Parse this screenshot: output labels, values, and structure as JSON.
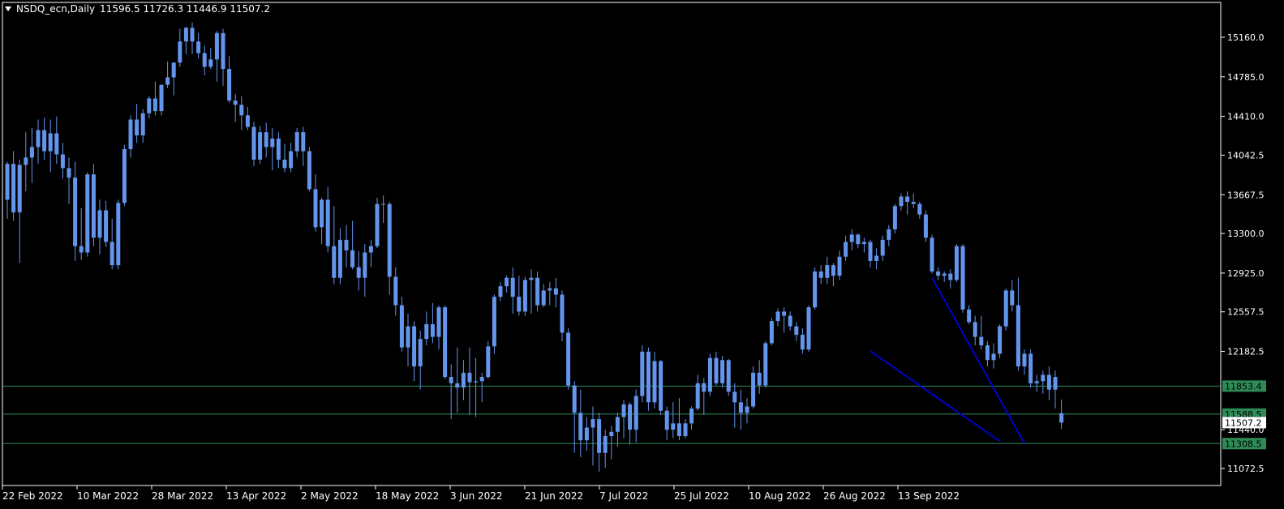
{
  "header": {
    "symbol": "NSDQ_ecn,Daily",
    "ohlc": "11596.5 11726.3 11446.9 11507.2"
  },
  "colors": {
    "background": "#000000",
    "frame": "#ffffff",
    "candle": "#6495ed",
    "level_line": "#2e8b57",
    "level_label_bg": "#2e8b57",
    "trend_line": "#0000cd",
    "current_price_bg": "#ffffff"
  },
  "price_scale": {
    "ticks": [
      "15160.0",
      "14785.0",
      "14410.0",
      "14042.5",
      "13667.5",
      "13300.0",
      "12925.0",
      "12557.5",
      "12182.5",
      "11440.0",
      "11072.5"
    ],
    "levels": [
      {
        "label": "11853.4",
        "value": 11853.4
      },
      {
        "label": "11588.5",
        "value": 11588.5
      },
      {
        "label": "11308.5",
        "value": 11308.5
      }
    ],
    "current_price": {
      "label": "11507.2",
      "value": 11507.2
    }
  },
  "time_scale": {
    "ticks": [
      "22 Feb 2022",
      "10 Mar 2022",
      "28 Mar 2022",
      "13 Apr 2022",
      "2 May 2022",
      "18 May 2022",
      "3 Jun 2022",
      "21 Jun 2022",
      "7 Jul 2022",
      "25 Jul 2022",
      "10 Aug 2022",
      "26 Aug 2022",
      "13 Sep 2022"
    ]
  },
  "chart_data": {
    "type": "candlestick",
    "symbol": "NSDQ_ecn",
    "timeframe": "Daily",
    "ylim": [
      10950,
      15500
    ],
    "last": {
      "open": 11596.5,
      "high": 11726.3,
      "low": 11446.9,
      "close": 11507.2
    },
    "trend_lines": [
      {
        "from": {
          "bar": 150,
          "price": 12880
        },
        "to": {
          "bar": 165,
          "price": 11310
        }
      },
      {
        "from": {
          "bar": 140,
          "price": 12185
        },
        "to": {
          "bar": 161,
          "price": 11330
        }
      }
    ],
    "candles": [
      [
        13620,
        13980,
        13440,
        13960
      ],
      [
        13960,
        14080,
        13420,
        13500
      ],
      [
        13500,
        14000,
        13020,
        13950
      ],
      [
        13950,
        14260,
        13700,
        14020
      ],
      [
        14020,
        14300,
        13780,
        14120
      ],
      [
        14120,
        14380,
        13960,
        14280
      ],
      [
        14280,
        14400,
        14000,
        14080
      ],
      [
        14080,
        14380,
        13880,
        14250
      ],
      [
        14250,
        14410,
        13960,
        14050
      ],
      [
        14050,
        14160,
        13820,
        13920
      ],
      [
        13920,
        14020,
        13580,
        13830
      ],
      [
        13830,
        13980,
        13040,
        13180
      ],
      [
        13180,
        13540,
        13050,
        13120
      ],
      [
        13120,
        13880,
        13080,
        13860
      ],
      [
        13860,
        13960,
        13180,
        13260
      ],
      [
        13260,
        13620,
        13100,
        13520
      ],
      [
        13520,
        13610,
        13170,
        13220
      ],
      [
        13220,
        13440,
        12960,
        13000
      ],
      [
        13000,
        13620,
        12960,
        13590
      ],
      [
        13590,
        14140,
        13560,
        14100
      ],
      [
        14100,
        14420,
        14020,
        14380
      ],
      [
        14380,
        14530,
        14160,
        14230
      ],
      [
        14230,
        14480,
        14160,
        14440
      ],
      [
        14440,
        14600,
        14390,
        14580
      ],
      [
        14580,
        14740,
        14420,
        14460
      ],
      [
        14460,
        14680,
        14420,
        14710
      ],
      [
        14710,
        14930,
        14680,
        14780
      ],
      [
        14780,
        14850,
        14610,
        14920
      ],
      [
        14920,
        15240,
        14880,
        15120
      ],
      [
        15120,
        15260,
        15000,
        15250
      ],
      [
        15250,
        15300,
        15000,
        15120
      ],
      [
        15120,
        15200,
        14960,
        15010
      ],
      [
        15010,
        15080,
        14800,
        14880
      ],
      [
        14880,
        15060,
        14860,
        14950
      ],
      [
        14950,
        15220,
        14740,
        15200
      ],
      [
        15200,
        15240,
        14700,
        14860
      ],
      [
        14860,
        14980,
        14540,
        14560
      ],
      [
        14560,
        14620,
        14360,
        14520
      ],
      [
        14520,
        14600,
        14280,
        14420
      ],
      [
        14420,
        14500,
        14280,
        14310
      ],
      [
        14310,
        14360,
        13940,
        14000
      ],
      [
        14000,
        14320,
        13960,
        14260
      ],
      [
        14260,
        14350,
        14020,
        14120
      ],
      [
        14120,
        14300,
        13900,
        14200
      ],
      [
        14200,
        14260,
        13920,
        14000
      ],
      [
        14000,
        14150,
        13880,
        13920
      ],
      [
        13920,
        14160,
        13880,
        14080
      ],
      [
        14080,
        14300,
        14020,
        14260
      ],
      [
        14260,
        14310,
        13940,
        14080
      ],
      [
        14080,
        14120,
        13700,
        13720
      ],
      [
        13720,
        13860,
        13320,
        13360
      ],
      [
        13360,
        13640,
        13200,
        13620
      ],
      [
        13620,
        13740,
        13120,
        13180
      ],
      [
        13180,
        13560,
        12820,
        12880
      ],
      [
        12880,
        13350,
        12820,
        13240
      ],
      [
        13240,
        13380,
        12980,
        13140
      ],
      [
        13140,
        13420,
        12960,
        12980
      ],
      [
        12980,
        13130,
        12760,
        12880
      ],
      [
        12880,
        13200,
        12700,
        13120
      ],
      [
        13120,
        13240,
        12980,
        13180
      ],
      [
        13180,
        13640,
        13160,
        13580
      ],
      [
        13580,
        13660,
        13400,
        13580
      ],
      [
        13580,
        13600,
        12720,
        12890
      ],
      [
        12890,
        12980,
        12520,
        12620
      ],
      [
        12620,
        12700,
        12180,
        12220
      ],
      [
        12220,
        12540,
        12040,
        12420
      ],
      [
        12420,
        12470,
        11900,
        12040
      ],
      [
        12040,
        12380,
        11820,
        12300
      ],
      [
        12300,
        12560,
        12240,
        12440
      ],
      [
        12440,
        12640,
        12260,
        12320
      ],
      [
        12320,
        12620,
        12200,
        12600
      ],
      [
        12600,
        12620,
        11920,
        11940
      ],
      [
        11940,
        12060,
        11540,
        11880
      ],
      [
        11880,
        12220,
        11600,
        11840
      ],
      [
        11840,
        12100,
        11720,
        11980
      ],
      [
        11980,
        12220,
        11580,
        11890
      ],
      [
        11890,
        12120,
        11560,
        11900
      ],
      [
        11900,
        11980,
        11700,
        11940
      ],
      [
        11940,
        12280,
        11920,
        12230
      ],
      [
        12230,
        12720,
        12160,
        12700
      ],
      [
        12700,
        12840,
        12660,
        12800
      ],
      [
        12800,
        12900,
        12740,
        12880
      ],
      [
        12880,
        12980,
        12540,
        12700
      ],
      [
        12700,
        12900,
        12520,
        12560
      ],
      [
        12560,
        12890,
        12520,
        12860
      ],
      [
        12860,
        12960,
        12540,
        12880
      ],
      [
        12880,
        12940,
        12560,
        12620
      ],
      [
        12620,
        12820,
        12600,
        12760
      ],
      [
        12760,
        12840,
        12620,
        12780
      ],
      [
        12780,
        12880,
        12600,
        12720
      ],
      [
        12720,
        12760,
        12280,
        12360
      ],
      [
        12360,
        12400,
        11820,
        11860
      ],
      [
        11860,
        11900,
        11220,
        11600
      ],
      [
        11600,
        11820,
        11180,
        11340
      ],
      [
        11340,
        11560,
        11240,
        11460
      ],
      [
        11460,
        11660,
        11100,
        11540
      ],
      [
        11540,
        11600,
        11040,
        11220
      ],
      [
        11220,
        11440,
        11080,
        11380
      ],
      [
        11380,
        11480,
        11160,
        11420
      ],
      [
        11420,
        11600,
        11280,
        11560
      ],
      [
        11560,
        11720,
        11360,
        11680
      ],
      [
        11680,
        11700,
        11300,
        11440
      ],
      [
        11440,
        11820,
        11320,
        11760
      ],
      [
        11760,
        12240,
        11700,
        12180
      ],
      [
        12180,
        12220,
        11620,
        11700
      ],
      [
        11700,
        12180,
        11640,
        12090
      ],
      [
        12090,
        12100,
        11580,
        11620
      ],
      [
        11620,
        11660,
        11340,
        11440
      ],
      [
        11440,
        11700,
        11360,
        11500
      ],
      [
        11500,
        11740,
        11340,
        11380
      ],
      [
        11380,
        11540,
        11360,
        11500
      ],
      [
        11500,
        11660,
        11440,
        11640
      ],
      [
        11640,
        11960,
        11620,
        11880
      ],
      [
        11880,
        11930,
        11580,
        11800
      ],
      [
        11800,
        12160,
        11760,
        12120
      ],
      [
        12120,
        12180,
        11860,
        11880
      ],
      [
        11880,
        12140,
        11840,
        12100
      ],
      [
        12100,
        12110,
        11760,
        11800
      ],
      [
        11800,
        11880,
        11460,
        11700
      ],
      [
        11700,
        11820,
        11440,
        11600
      ],
      [
        11600,
        11740,
        11500,
        11660
      ],
      [
        11660,
        12040,
        11640,
        11980
      ],
      [
        11980,
        12100,
        11780,
        11860
      ],
      [
        11860,
        12280,
        11840,
        12260
      ],
      [
        12260,
        12500,
        12240,
        12470
      ],
      [
        12470,
        12590,
        12420,
        12560
      ],
      [
        12560,
        12600,
        12360,
        12520
      ],
      [
        12520,
        12560,
        12380,
        12420
      ],
      [
        12420,
        12460,
        12280,
        12340
      ],
      [
        12340,
        12400,
        12160,
        12200
      ],
      [
        12200,
        12620,
        12180,
        12600
      ],
      [
        12600,
        12980,
        12580,
        12940
      ],
      [
        12940,
        13000,
        12820,
        12880
      ],
      [
        12880,
        13080,
        12820,
        13000
      ],
      [
        13000,
        13020,
        12800,
        12900
      ],
      [
        12900,
        13140,
        12860,
        13080
      ],
      [
        13080,
        13280,
        13040,
        13220
      ],
      [
        13220,
        13340,
        13140,
        13290
      ],
      [
        13290,
        13300,
        13160,
        13200
      ],
      [
        13200,
        13260,
        13120,
        13220
      ],
      [
        13220,
        13240,
        12980,
        13040
      ],
      [
        13040,
        13160,
        12960,
        13090
      ],
      [
        13090,
        13280,
        13040,
        13240
      ],
      [
        13240,
        13380,
        13180,
        13340
      ],
      [
        13340,
        13580,
        13300,
        13560
      ],
      [
        13560,
        13680,
        13520,
        13650
      ],
      [
        13650,
        13700,
        13480,
        13600
      ],
      [
        13600,
        13680,
        13540,
        13580
      ],
      [
        13580,
        13600,
        13440,
        13480
      ],
      [
        13480,
        13520,
        13220,
        13260
      ],
      [
        13260,
        13290,
        12920,
        12940
      ],
      [
        12940,
        12980,
        12860,
        12900
      ],
      [
        12900,
        12940,
        12840,
        12920
      ],
      [
        12920,
        12960,
        12780,
        12860
      ],
      [
        12860,
        13200,
        12840,
        13180
      ],
      [
        13180,
        13200,
        12550,
        12580
      ],
      [
        12580,
        12620,
        12440,
        12460
      ],
      [
        12460,
        12520,
        12240,
        12320
      ],
      [
        12320,
        12520,
        12200,
        12240
      ],
      [
        12240,
        12280,
        12040,
        12100
      ],
      [
        12100,
        12260,
        12020,
        12160
      ],
      [
        12160,
        12440,
        12120,
        12420
      ],
      [
        12420,
        12780,
        12380,
        12760
      ],
      [
        12760,
        12860,
        12560,
        12620
      ],
      [
        12620,
        12880,
        12000,
        12040
      ],
      [
        12040,
        12200,
        11960,
        12160
      ],
      [
        12160,
        12200,
        11840,
        11880
      ],
      [
        11880,
        11960,
        11800,
        11900
      ],
      [
        11900,
        12000,
        11780,
        11960
      ],
      [
        11960,
        12040,
        11720,
        11820
      ],
      [
        11820,
        12000,
        11640,
        11940
      ],
      [
        11596.5,
        11726.3,
        11446.9,
        11507.2
      ]
    ]
  }
}
